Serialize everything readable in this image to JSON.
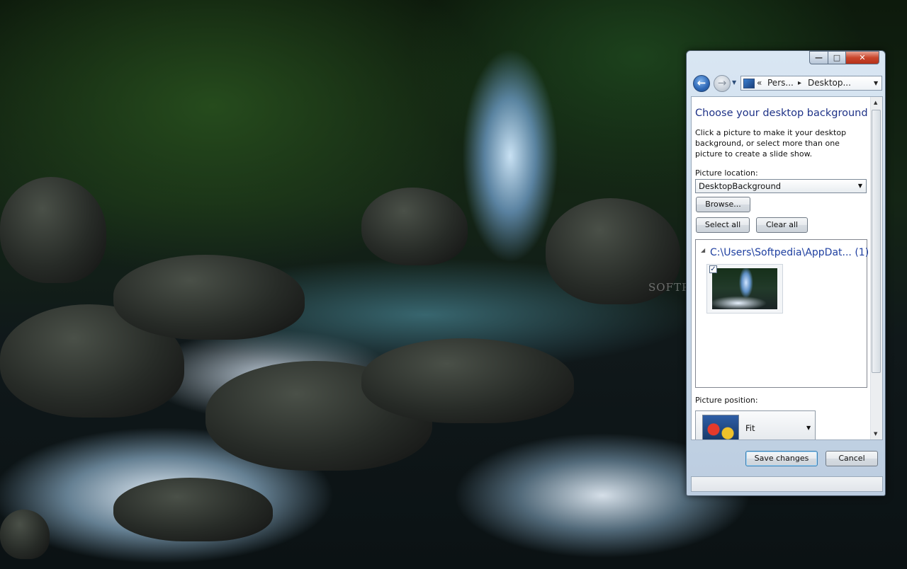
{
  "window": {
    "caption_buttons": {
      "minimize": "—",
      "maximize": "□",
      "close": "✕"
    },
    "nav": {
      "back_glyph": "←",
      "forward_glyph": "→",
      "history_glyph": "▼"
    },
    "address": {
      "chevrons": "«",
      "crumb1": "Pers...",
      "separator": "▸",
      "crumb2": "Desktop...",
      "dropdown": "▼"
    }
  },
  "content": {
    "heading": "Choose your desktop background",
    "description": "Click a picture to make it your desktop background, or select more than one picture to create a slide show.",
    "picture_location_label": "Picture location:",
    "picture_location_value": "DesktopBackground",
    "browse_label": "Browse...",
    "select_all_label": "Select all",
    "clear_all_label": "Clear all",
    "group_toggle": "◢",
    "group_header": "C:\\Users\\Softpedia\\AppDat... (1)",
    "thumbnail_checked": "✓",
    "picture_position_label": "Picture position:",
    "picture_position_value": "Fit",
    "dropdown_glyph": "▼"
  },
  "footer": {
    "save_label": "Save changes",
    "cancel_label": "Cancel"
  },
  "watermark": "SOFTPEDIA",
  "scrollbar": {
    "up": "▲",
    "down": "▼"
  }
}
